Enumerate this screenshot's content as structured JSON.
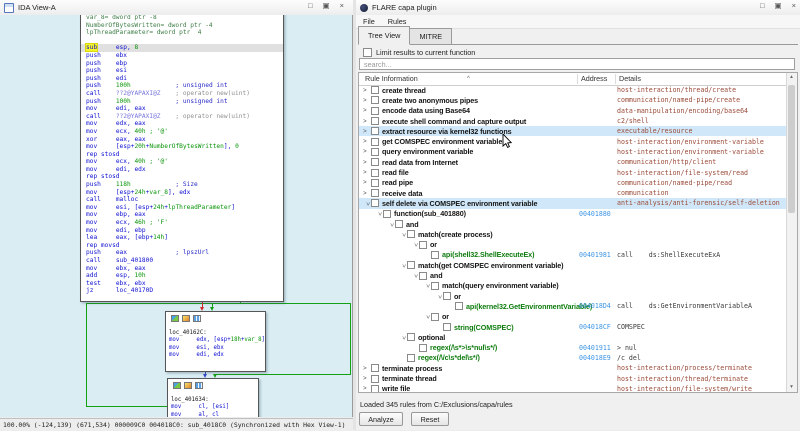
{
  "colors": {
    "graph_bg": "#d9edf3",
    "edge_green": "#14a014",
    "edge_red": "#d22929",
    "edge_blue": "#3548c8",
    "row_highlight": "#cfe7f8",
    "addr_blue": "#3d95e5",
    "feat_green": "#0e7c0e",
    "ns_brown": "#9a4a38"
  },
  "ida": {
    "title": "IDA View-A",
    "controls": {
      "maximize": "□",
      "float": "▣",
      "close": "×"
    },
    "status": "100.00% (-124,139) (671,534) 000009C0 004018C0: sub_4018C0 (Synchronized with Hex View-1)",
    "node1_lines": [
      [
        [
          "v",
          "var_8= dword ptr -8"
        ]
      ],
      [
        [
          "v",
          "NumberOfBytesWritten= dword ptr -4"
        ]
      ],
      [
        [
          "v",
          "lpThreadParameter= dword ptr  4"
        ]
      ],
      [],
      [
        [
          "hlw",
          "sub"
        ],
        [
          "o",
          "     esp, "
        ],
        [
          "n",
          "8"
        ]
      ],
      [
        [
          "k",
          "push    "
        ],
        [
          "o",
          "ebx"
        ]
      ],
      [
        [
          "k",
          "push    "
        ],
        [
          "o",
          "ebp"
        ]
      ],
      [
        [
          "k",
          "push    "
        ],
        [
          "o",
          "esi"
        ]
      ],
      [
        [
          "k",
          "push    "
        ],
        [
          "o",
          "edi"
        ]
      ],
      [
        [
          "k",
          "push    "
        ],
        [
          "n",
          "100h"
        ],
        [
          "o",
          "            "
        ],
        [
          "cb",
          "; unsigned int"
        ]
      ],
      [
        [
          "k",
          "call    "
        ],
        [
          "imp",
          "??2@YAPAXI@Z"
        ],
        [
          "o",
          "    "
        ],
        [
          "cg",
          "; operator new(uint)"
        ]
      ],
      [
        [
          "k",
          "push    "
        ],
        [
          "n",
          "100h"
        ],
        [
          "o",
          "            "
        ],
        [
          "cb",
          "; unsigned int"
        ]
      ],
      [
        [
          "k",
          "mov     "
        ],
        [
          "o",
          "edi, eax"
        ]
      ],
      [
        [
          "k",
          "call    "
        ],
        [
          "imp",
          "??2@YAPAXI@Z"
        ],
        [
          "o",
          "    "
        ],
        [
          "cg",
          "; operator new(uint)"
        ]
      ],
      [
        [
          "k",
          "mov     "
        ],
        [
          "o",
          "edx, eax"
        ]
      ],
      [
        [
          "k",
          "mov     "
        ],
        [
          "o",
          "ecx, "
        ],
        [
          "n",
          "40h"
        ],
        [
          "n",
          " ; '@'"
        ]
      ],
      [
        [
          "k",
          "xor     "
        ],
        [
          "o",
          "eax, eax"
        ]
      ],
      [
        [
          "k",
          "mov     "
        ],
        [
          "o",
          "[esp+"
        ],
        [
          "n",
          "20h"
        ],
        [
          "o",
          "+"
        ],
        [
          "vn",
          "NumberOfBytesWritten"
        ],
        [
          "o",
          "], "
        ],
        [
          "n",
          "0"
        ]
      ],
      [
        [
          "k",
          "rep stosd"
        ]
      ],
      [
        [
          "k",
          "mov     "
        ],
        [
          "o",
          "ecx, "
        ],
        [
          "n",
          "40h"
        ],
        [
          "n",
          " ; '@'"
        ]
      ],
      [
        [
          "k",
          "mov     "
        ],
        [
          "o",
          "edi, edx"
        ]
      ],
      [
        [
          "k",
          "rep stosd"
        ]
      ],
      [
        [
          "k",
          "push    "
        ],
        [
          "n",
          "118h"
        ],
        [
          "o",
          "            "
        ],
        [
          "cb",
          "; Size"
        ]
      ],
      [
        [
          "k",
          "mov     "
        ],
        [
          "o",
          "[esp+"
        ],
        [
          "n",
          "24h"
        ],
        [
          "o",
          "+"
        ],
        [
          "vn",
          "var_8"
        ],
        [
          "o",
          "], edx"
        ]
      ],
      [
        [
          "k",
          "call    "
        ],
        [
          "fn",
          "malloc"
        ]
      ],
      [
        [
          "k",
          "mov     "
        ],
        [
          "o",
          "esi, [esp+"
        ],
        [
          "n",
          "24h"
        ],
        [
          "o",
          "+"
        ],
        [
          "vn",
          "lpThreadParameter"
        ],
        [
          "o",
          "]"
        ]
      ],
      [
        [
          "k",
          "mov     "
        ],
        [
          "o",
          "ebp, eax"
        ]
      ],
      [
        [
          "k",
          "mov     "
        ],
        [
          "o",
          "ecx, "
        ],
        [
          "n",
          "46h"
        ],
        [
          "n",
          " ; 'F'"
        ]
      ],
      [
        [
          "k",
          "mov     "
        ],
        [
          "o",
          "edi, ebp"
        ]
      ],
      [
        [
          "k",
          "lea     "
        ],
        [
          "o",
          "eax, [ebp+"
        ],
        [
          "n",
          "14h"
        ],
        [
          "o",
          "]"
        ]
      ],
      [
        [
          "k",
          "rep movsd"
        ]
      ],
      [
        [
          "k",
          "push    "
        ],
        [
          "o",
          "eax             "
        ],
        [
          "cb",
          "; lpszUrl"
        ]
      ],
      [
        [
          "k",
          "call    "
        ],
        [
          "fn",
          "sub_401800"
        ]
      ],
      [
        [
          "k",
          "mov     "
        ],
        [
          "o",
          "ebx, eax"
        ]
      ],
      [
        [
          "k",
          "add     "
        ],
        [
          "o",
          "esp, "
        ],
        [
          "n",
          "10h"
        ]
      ],
      [
        [
          "k",
          "test    "
        ],
        [
          "o",
          "ebx, ebx"
        ]
      ],
      [
        [
          "k",
          "jz      "
        ],
        [
          "fn",
          "loc_40170D"
        ]
      ]
    ],
    "node2_lines": [
      [],
      [
        [
          "lbl",
          "loc_40162C:"
        ]
      ],
      [
        [
          "k",
          "mov     "
        ],
        [
          "o",
          "edx, [esp+"
        ],
        [
          "n",
          "18h"
        ],
        [
          "o",
          "+"
        ],
        [
          "vn",
          "var_8"
        ],
        [
          "o",
          "]"
        ]
      ],
      [
        [
          "k",
          "mov     "
        ],
        [
          "o",
          "esi, ebx"
        ]
      ],
      [
        [
          "k",
          "mov     "
        ],
        [
          "o",
          "edi, edx"
        ]
      ]
    ],
    "node3_lines": [
      [],
      [
        [
          "lbl",
          "loc_401634:"
        ]
      ],
      [
        [
          "k",
          "mov     "
        ],
        [
          "o",
          "cl, [esi]"
        ]
      ],
      [
        [
          "k",
          "mov     "
        ],
        [
          "o",
          "al, cl"
        ]
      ]
    ]
  },
  "capa": {
    "title": "FLARE capa plugin",
    "controls": {
      "maximize": "□",
      "float": "▣",
      "close": "×"
    },
    "menu": [
      "File",
      "Rules"
    ],
    "tabs": [
      "Tree View",
      "MITRE"
    ],
    "limit_label": "Limit results to current function",
    "search_placeholder": "search...",
    "columns": [
      "Rule Information",
      "Address",
      "Details"
    ],
    "status": "Loaded 345 rules from C:/Exclusions/capa/rules",
    "analyze_label": "Analyze",
    "reset_label": "Reset",
    "rows": [
      {
        "lvl": 0,
        "e": ">",
        "label": "create thread",
        "kind": "rule",
        "addr": "",
        "det": "host-interaction/thread/create",
        "detk": "ns",
        "hl": false
      },
      {
        "lvl": 0,
        "e": ">",
        "label": "create two anonymous pipes",
        "kind": "rule",
        "addr": "",
        "det": "communication/named-pipe/create",
        "detk": "ns",
        "hl": false
      },
      {
        "lvl": 0,
        "e": ">",
        "label": "encode data using Base64",
        "kind": "rule",
        "addr": "",
        "det": "data-manipulation/encoding/base64",
        "detk": "ns",
        "hl": false
      },
      {
        "lvl": 0,
        "e": ">",
        "label": "execute shell command and capture output",
        "kind": "rule",
        "addr": "",
        "det": "c2/shell",
        "detk": "ns",
        "hl": false
      },
      {
        "lvl": 0,
        "e": ">",
        "label": "extract resource via kernel32 functions",
        "kind": "rule",
        "addr": "",
        "det": "executable/resource",
        "detk": "ns",
        "hl": true
      },
      {
        "lvl": 0,
        "e": ">",
        "label": "get COMSPEC environment variable",
        "kind": "rule",
        "addr": "",
        "det": "host-interaction/environment-variable",
        "detk": "ns",
        "hl": false
      },
      {
        "lvl": 0,
        "e": ">",
        "label": "query environment variable",
        "kind": "rule",
        "addr": "",
        "det": "host-interaction/environment-variable",
        "detk": "ns",
        "hl": false
      },
      {
        "lvl": 0,
        "e": ">",
        "label": "read data from Internet",
        "kind": "rule",
        "addr": "",
        "det": "communication/http/client",
        "detk": "ns",
        "hl": false
      },
      {
        "lvl": 0,
        "e": ">",
        "label": "read file",
        "kind": "rule",
        "addr": "",
        "det": "host-interaction/file-system/read",
        "detk": "ns",
        "hl": false
      },
      {
        "lvl": 0,
        "e": ">",
        "label": "read pipe",
        "kind": "rule",
        "addr": "",
        "det": "communication/named-pipe/read",
        "detk": "ns",
        "hl": false
      },
      {
        "lvl": 0,
        "e": ">",
        "label": "receive data",
        "kind": "rule",
        "addr": "",
        "det": "communication",
        "detk": "ns",
        "hl": false
      },
      {
        "lvl": 0,
        "e": "v",
        "label": "self delete via COMSPEC environment variable",
        "kind": "rule",
        "addr": "",
        "det": "anti-analysis/anti-forensic/self-deletion",
        "detk": "ns",
        "hl": true
      },
      {
        "lvl": 1,
        "e": "v",
        "label": "function(sub_401880)",
        "kind": "stmt",
        "addr": "00401880",
        "det": "",
        "detk": "",
        "hl": false
      },
      {
        "lvl": 2,
        "e": "v",
        "label": "and",
        "kind": "stmt",
        "addr": "",
        "det": "",
        "detk": "",
        "hl": false
      },
      {
        "lvl": 3,
        "e": "v",
        "label": "match(create process)",
        "kind": "stmt",
        "addr": "",
        "det": "",
        "detk": "",
        "hl": false
      },
      {
        "lvl": 4,
        "e": "v",
        "label": "or",
        "kind": "stmt",
        "addr": "",
        "det": "",
        "detk": "",
        "hl": false
      },
      {
        "lvl": 5,
        "e": "",
        "label": "api(shell32.ShellExecuteEx)",
        "kind": "feat",
        "addr": "00401981",
        "det": "call    ds:ShellExecuteExA",
        "detk": "asm",
        "hl": false
      },
      {
        "lvl": 3,
        "e": "v",
        "label": "match(get COMSPEC environment variable)",
        "kind": "stmt",
        "addr": "",
        "det": "",
        "detk": "",
        "hl": false
      },
      {
        "lvl": 4,
        "e": "v",
        "label": "and",
        "kind": "stmt",
        "addr": "",
        "det": "",
        "detk": "",
        "hl": false
      },
      {
        "lvl": 5,
        "e": "v",
        "label": "match(query environment variable)",
        "kind": "stmt",
        "addr": "",
        "det": "",
        "detk": "",
        "hl": false
      },
      {
        "lvl": 6,
        "e": "v",
        "label": "or",
        "kind": "stmt",
        "addr": "",
        "det": "",
        "detk": "",
        "hl": false
      },
      {
        "lvl": 7,
        "e": "",
        "label": "api(kernel32.GetEnvironmentVariable)",
        "kind": "feat",
        "addr": "004018D4",
        "det": "call    ds:GetEnvironmentVariableA",
        "detk": "asm",
        "hl": false
      },
      {
        "lvl": 5,
        "e": "v",
        "label": "or",
        "kind": "stmt",
        "addr": "",
        "det": "",
        "detk": "",
        "hl": false
      },
      {
        "lvl": 6,
        "e": "",
        "label": "string(COMSPEC)",
        "kind": "feat",
        "addr": "004018CF",
        "det": "COMSPEC",
        "detk": "asm",
        "hl": false
      },
      {
        "lvl": 3,
        "e": "v",
        "label": "optional",
        "kind": "stmt",
        "addr": "",
        "det": "",
        "detk": "",
        "hl": false
      },
      {
        "lvl": 4,
        "e": "",
        "label": "regex(/\\s*>\\s*nul\\s*/)",
        "kind": "feat",
        "addr": "00401911",
        "det": "> nul",
        "detk": "asm",
        "hl": false
      },
      {
        "lvl": 3,
        "e": "",
        "label": "regex(/\\/c\\s*del\\s*/)",
        "kind": "feat",
        "addr": "004018E9",
        "det": "/c del",
        "detk": "asm",
        "hl": false
      },
      {
        "lvl": 0,
        "e": ">",
        "label": "terminate process",
        "kind": "rule",
        "addr": "",
        "det": "host-interaction/process/terminate",
        "detk": "ns",
        "hl": false
      },
      {
        "lvl": 0,
        "e": ">",
        "label": "terminate thread",
        "kind": "rule",
        "addr": "",
        "det": "host-interaction/thread/terminate",
        "detk": "ns",
        "hl": false
      },
      {
        "lvl": 0,
        "e": ">",
        "label": "write file",
        "kind": "rule",
        "addr": "",
        "det": "host-interaction/file-system/write",
        "detk": "ns",
        "hl": false
      }
    ]
  }
}
